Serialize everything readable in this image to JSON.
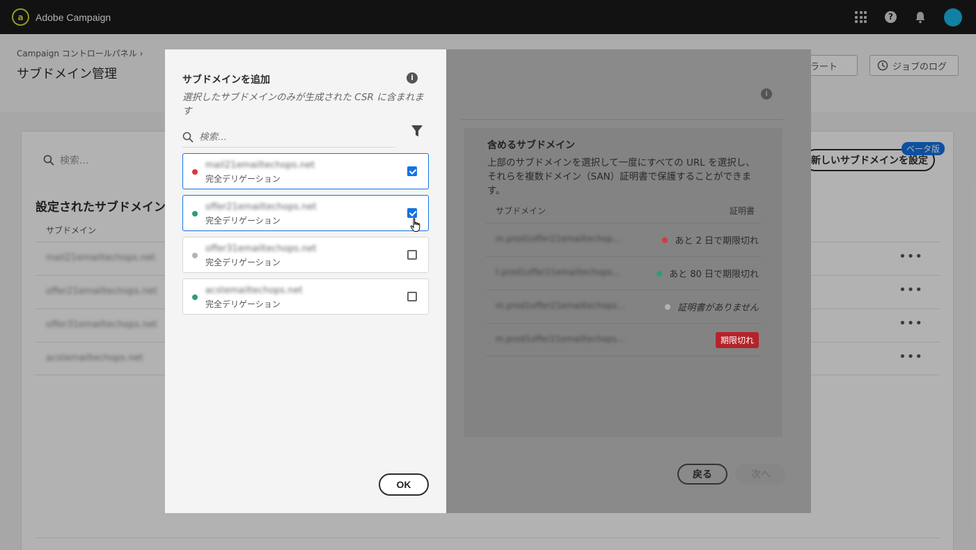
{
  "app": {
    "title": "Adobe Campaign",
    "logo_glyph": "a"
  },
  "topbar": {
    "icons": [
      "apps-grid-icon",
      "help-icon",
      "bell-icon",
      "avatar"
    ],
    "help_glyph": "?"
  },
  "page": {
    "breadcrumb": "Campaign コントロールパネル",
    "breadcrumb_sep": "›",
    "title": "サブドメイン管理",
    "alerts_label": "アラート",
    "job_logs_label": "ジョブのログ",
    "search_placeholder": "検索...",
    "section_title": "設定されたサブドメイン",
    "column_subdomain": "サブドメイン",
    "new_button": "新しいサブドメインを設定",
    "beta_badge": "ベータ版",
    "rows": [
      {
        "name": "mail21emailtechops.net",
        "more": "•••"
      },
      {
        "name": "offer21emailtechops.net",
        "more": "•••"
      },
      {
        "name": "offer31emailtechops.net",
        "more": "•••"
      },
      {
        "name": "acstemailtechops.net",
        "more": "•••"
      }
    ]
  },
  "wizard": {
    "info_glyph": "i",
    "include_title": "含めるサブドメイン",
    "include_desc": "上部のサブドメインを選択して一度にすべての URL を選択し、それらを複数ドメイン（SAN）証明書で保護することができます。",
    "col_subdomain": "サブドメイン",
    "col_certificate": "証明書",
    "rows": [
      {
        "sub": "m.prod1offer21emailtechop...",
        "status": "あと 2 日で期限切れ",
        "dot": "#d7373f",
        "kind": "text"
      },
      {
        "sub": "t.prod1offer21emailtechops...",
        "status": "あと 80 日で期限切れ",
        "dot": "#2d9d78",
        "kind": "text"
      },
      {
        "sub": "m.prod1offer21emailtechops...",
        "status": "証明書がありません",
        "dot": "#b3b3b3",
        "kind": "italic"
      },
      {
        "sub": "m.prod1offer21emailtechops...",
        "status": "期限切れ",
        "dot": "",
        "kind": "badge"
      }
    ],
    "back_label": "戻る",
    "next_label": "次へ"
  },
  "add_dialog": {
    "title": "サブドメインを追加",
    "info_glyph": "i",
    "description": "選択したサブドメインのみが生成された CSR に含まれます",
    "search_placeholder": "検索...",
    "items": [
      {
        "name": "mail21emailtechops.net",
        "type": "完全デリゲーション",
        "dot": "#d7373f",
        "checked": true
      },
      {
        "name": "offer21emailtechops.net",
        "type": "完全デリゲーション",
        "dot": "#2d9d78",
        "checked": true
      },
      {
        "name": "offer31emailtechops.net",
        "type": "完全デリゲーション",
        "dot": "#b3b3b3",
        "checked": false
      },
      {
        "name": "acstemailtechops.net",
        "type": "完全デリゲーション",
        "dot": "#2d9d78",
        "checked": false
      }
    ],
    "ok_label": "OK"
  }
}
